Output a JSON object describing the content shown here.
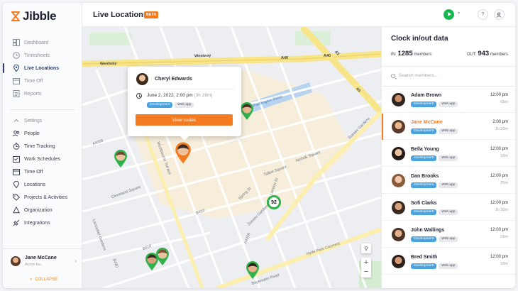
{
  "app": {
    "brand": "Jibble",
    "page_title": "Live Locations",
    "beta_badge": "BETA"
  },
  "colors": {
    "accent": "#f47b20",
    "green": "#17b651",
    "tag_blue": "#4aa3df",
    "navy": "#2a3a66"
  },
  "sidebar": {
    "primary": [
      {
        "label": "Dashboard",
        "icon": "dashboard-icon"
      },
      {
        "label": "Timesheets",
        "icon": "clock-icon"
      },
      {
        "label": "Live Locations",
        "icon": "map-pin-icon",
        "active": true
      },
      {
        "label": "Time Off",
        "icon": "calendar-icon"
      },
      {
        "label": "Reports",
        "icon": "report-icon"
      }
    ],
    "settings_label": "Settings",
    "settings": [
      {
        "label": "People",
        "icon": "people-icon"
      },
      {
        "label": "Time Tracking",
        "icon": "time-tracking-icon"
      },
      {
        "label": "Work Schedules",
        "icon": "schedule-icon"
      },
      {
        "label": "Time Off",
        "icon": "calendar-icon"
      },
      {
        "label": "Locations",
        "icon": "location-icon"
      },
      {
        "label": "Projects & Activities",
        "icon": "tag-icon"
      },
      {
        "label": "Organization",
        "icon": "org-icon"
      },
      {
        "label": "Integrations",
        "icon": "integrations-icon"
      }
    ],
    "user": {
      "name": "Jane McCane",
      "org": "Acme Inc."
    },
    "collapse_label": "COLLAPSE"
  },
  "map": {
    "labels": {
      "westway": "Westway",
      "a40": "A40",
      "a40_2": "A40",
      "a5": "A5",
      "a5_2": "A5",
      "a4206": "A4206",
      "a4209": "A4209",
      "b410": "B410",
      "b410_2": "B410",
      "b410_3": "B410",
      "basin": "Paddington Basin",
      "sussex_gardens": "Sussex Gardens",
      "sussex_gardens_2": "Sussex Gardens",
      "spring_st": "Spring St",
      "london_st": "London St",
      "bayswater": "Bayswater Road",
      "hyde_park": "Hyde Park Crescent",
      "lancaster": "Lancaster Gardens",
      "westbourne": "Westbourne Terrace",
      "cleveland": "Cleveland Square",
      "talbot": "Talbot Square",
      "norfolk": "Norfolk Square"
    },
    "cluster_count": "92"
  },
  "popup": {
    "name": "Cheryl Edwards",
    "date": "June 2, 2022, 2:00 pm",
    "duration": "(3h 29m)",
    "tags": [
      "Development",
      "Web app"
    ],
    "button": "View routes"
  },
  "panel": {
    "title": "Clock in/out data",
    "in_label": "IN:",
    "in_count": "1285",
    "out_label": "OUT:",
    "out_count": "943",
    "members_word": "members",
    "search_placeholder": "Search members...",
    "members": [
      {
        "name": "Adam Brown",
        "tags": [
          "Development",
          "Web app"
        ],
        "time": "12:00 pm",
        "duration": "05m"
      },
      {
        "name": "Jane McCane",
        "tags": [
          "Development",
          "Web app"
        ],
        "time": "2:00 pm",
        "duration": "1h 20m",
        "active": true
      },
      {
        "name": "Bella Young",
        "tags": [
          "Development",
          "Web app"
        ],
        "time": "12:00 pm",
        "duration": "15m"
      },
      {
        "name": "Dan Brooks",
        "tags": [
          "Development",
          "Web app"
        ],
        "time": "12:00 pm",
        "duration": "25m"
      },
      {
        "name": "Sofi Clarks",
        "tags": [
          "Development",
          "Web app"
        ],
        "time": "12:00 pm",
        "duration": "1h 30m"
      },
      {
        "name": "John Wallings",
        "tags": [
          "Development",
          "Web app"
        ],
        "time": "12:00 pm",
        "duration": "05m"
      },
      {
        "name": "Bred Smith",
        "tags": [
          "Development",
          "Web app"
        ],
        "time": "12:00 pm",
        "duration": "10m"
      }
    ]
  }
}
